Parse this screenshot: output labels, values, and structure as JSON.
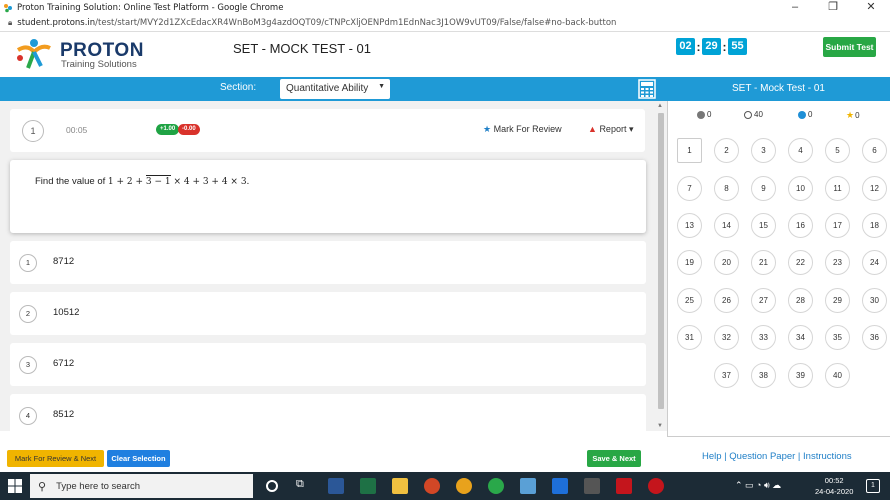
{
  "browser": {
    "window_title": "Proton Training Solution: Online Test Platform - Google Chrome",
    "url_host": "student.protons.in",
    "url_path": "/test/start/MVY2d1ZXcEdacXR4WnBoM3g4azdOQT09/cTNPcXljOENPdm1EdnNac3J1OW9vUT09/False/false#no-back-button"
  },
  "header": {
    "brand": "PROTON",
    "tagline": "Training Solutions",
    "test_name": "SET - MOCK TEST - 01",
    "timer": {
      "hours": "02",
      "minutes": "29",
      "seconds": "55"
    },
    "submit_label": "Submit Test"
  },
  "section_bar": {
    "label": "Section:",
    "selected": "Quantitative Ability",
    "right_title": "SET - Mock Test - 01"
  },
  "question": {
    "number": "1",
    "elapsed": "00:05",
    "marks_positive": "+1.00",
    "marks_negative": "-0.00",
    "mark_for_review": "Mark For Review",
    "report": "Report",
    "text_prefix": "Find the value of ",
    "expr_a": "1 + 2 + ",
    "expr_overline": "3  −  1",
    "expr_b": " × 4 + 3 + 4 × 3.",
    "options": [
      {
        "num": "1",
        "value": "8712"
      },
      {
        "num": "2",
        "value": "10512"
      },
      {
        "num": "3",
        "value": "6712"
      },
      {
        "num": "4",
        "value": "8512"
      }
    ]
  },
  "palette": {
    "legend": [
      {
        "count": "0",
        "color": "#777777"
      },
      {
        "count": "40",
        "color": "#ffffff"
      },
      {
        "count": "0",
        "color": "#1f8fd6"
      },
      {
        "count": "0",
        "color": "#f0b400"
      }
    ],
    "questions": [
      "1",
      "2",
      "3",
      "4",
      "5",
      "6",
      "7",
      "8",
      "9",
      "10",
      "11",
      "12",
      "13",
      "14",
      "15",
      "16",
      "17",
      "18",
      "19",
      "20",
      "21",
      "22",
      "23",
      "24",
      "25",
      "26",
      "27",
      "28",
      "29",
      "30",
      "31",
      "32",
      "33",
      "34",
      "35",
      "36",
      "37",
      "38",
      "39",
      "40"
    ],
    "current": "1"
  },
  "actions": {
    "mark_next": "Mark For Review & Next",
    "clear": "Clear Selection",
    "save_next": "Save & Next",
    "help": "Help | Question Paper | Instructions"
  },
  "taskbar": {
    "search_placeholder": "Type here to search",
    "time": "00:52",
    "date": "24-04-2020",
    "notifications": "1"
  }
}
